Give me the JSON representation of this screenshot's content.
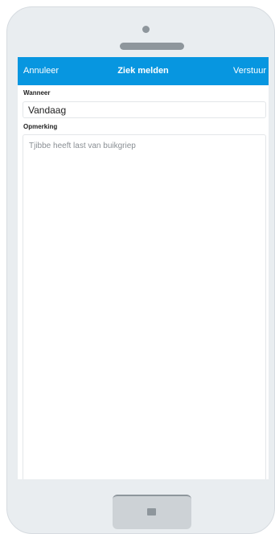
{
  "navbar": {
    "cancel_label": "Annuleer",
    "title": "Ziek melden",
    "send_label": "Verstuur",
    "color": "#0796e0"
  },
  "form": {
    "when_label": "Wanneer",
    "when_value": "Vandaag",
    "note_label": "Opmerking",
    "note_value": "Tjibbe heeft last van buikgriep"
  },
  "device": {
    "body_color": "#e9edf0",
    "home_icon": "square-icon"
  }
}
